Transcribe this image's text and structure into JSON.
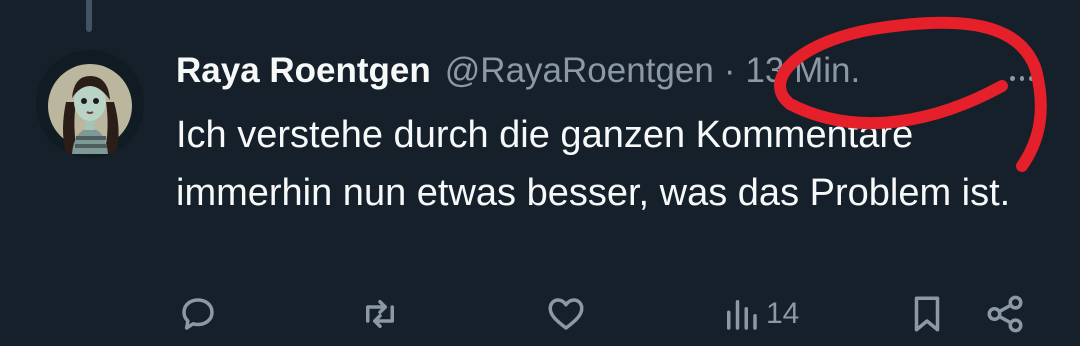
{
  "tweet": {
    "author_name": "Raya Roentgen",
    "handle": "@RayaRoentgen",
    "separator": "·",
    "time": "13 Min.",
    "text": "Ich verstehe durch die ganzen Kommentare immerhin nun etwas besser, was das Problem ist."
  },
  "actions": {
    "reply_icon": "reply-icon",
    "retweet_icon": "retweet-icon",
    "like_icon": "heart-icon",
    "views_icon": "views-icon",
    "views_count": "14",
    "bookmark_icon": "bookmark-icon",
    "share_icon": "share-icon"
  },
  "colors": {
    "background": "#15202b",
    "text": "#f7f9f9",
    "muted": "#8b98a5",
    "annotation": "#e5202a"
  }
}
